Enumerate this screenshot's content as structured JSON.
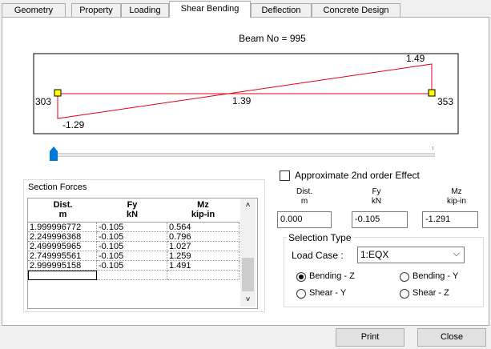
{
  "tabs": [
    "Geometry",
    "Property",
    "Loading",
    "Shear Bending",
    "Deflection",
    "Concrete Design"
  ],
  "beam_title": "Beam No = 995",
  "diagram": {
    "left_support": "303",
    "right_support": "353",
    "left_value": "-1.29",
    "mid_value": "1.39",
    "right_value": "1.49"
  },
  "slider": {
    "position": 0
  },
  "section_forces": {
    "title": "Section Forces",
    "headers": [
      {
        "line1": "Dist.",
        "line2": "m"
      },
      {
        "line1": "Fy",
        "line2": "kN"
      },
      {
        "line1": "Mz",
        "line2": "kip-in"
      }
    ],
    "rows": [
      [
        "1.999996772",
        "-0.105",
        "0.564"
      ],
      [
        "2.249996368",
        "-0.105",
        "0.796"
      ],
      [
        "2.499995965",
        "-0.105",
        "1.027"
      ],
      [
        "2.749995561",
        "-0.105",
        "1.259"
      ],
      [
        "2.999995158",
        "-0.105",
        "1.491"
      ]
    ]
  },
  "approx_label": "Approximate 2nd order Effect",
  "values_panel": {
    "dist_label": "Dist.",
    "dist_unit": "m",
    "fy_label": "Fy",
    "fy_unit": "kN",
    "mz_label": "Mz",
    "mz_unit": "kip-in",
    "dist": "0.000",
    "fy": "-0.105",
    "mz": "-1.291"
  },
  "selection_type": {
    "title": "Selection Type",
    "load_case_label": "Load Case :",
    "load_case_value": "1:EQX",
    "options": [
      "Bending - Z",
      "Bending - Y",
      "Shear - Y",
      "Shear - Z"
    ],
    "selected": "Bending - Z"
  },
  "buttons": {
    "print": "Print",
    "close": "Close"
  }
}
